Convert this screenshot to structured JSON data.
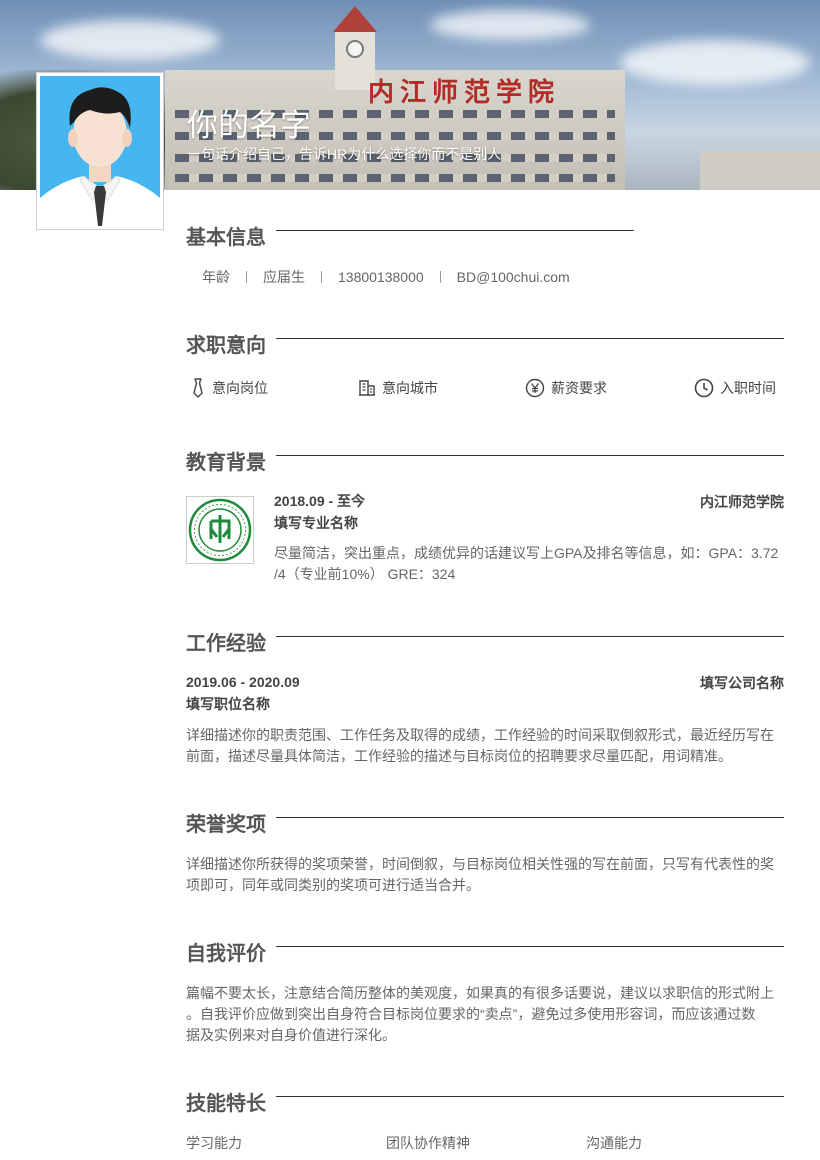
{
  "header": {
    "name": "你的名字",
    "tagline": "一句话介绍自己，告诉HR为什么选择你而不是别人",
    "campus_sign": "内江师范学院"
  },
  "sections": {
    "basic": "基本信息",
    "intent": "求职意向",
    "education": "教育背景",
    "work": "工作经验",
    "honors": "荣誉奖项",
    "self": "自我评价",
    "skills": "技能特长"
  },
  "basic_info": {
    "age": "年龄",
    "status": "应届生",
    "phone": "13800138000",
    "email": "BD@100chui.com"
  },
  "intent": {
    "position": "意向岗位",
    "city": "意向城市",
    "salary": "薪资要求",
    "start": "入职时间"
  },
  "education": {
    "period": "2018.09 - 至今",
    "school": "内江师范学院",
    "major": "填写专业名称",
    "desc_line1": "尽量简洁，突出重点，成绩优异的话建议写上GPA及排名等信息，如：GPA：3.72",
    "desc_line2": "/4（专业前10%） GRE：324"
  },
  "work": {
    "period": "2019.06 - 2020.09",
    "company": "填写公司名称",
    "title": "填写职位名称",
    "desc_line1": "详细描述你的职责范围、工作任务及取得的成绩，工作经验的时间采取倒叙形式，最近经历写在",
    "desc_line2": "前面，描述尽量具体简洁，工作经验的描述与目标岗位的招聘要求尽量匹配，用词精准。"
  },
  "honors": {
    "desc_line1": "详细描述你所获得的奖项荣誉，时间倒叙，与目标岗位相关性强的写在前面，只写有代表性的奖",
    "desc_line2": "项即可，同年或同类别的奖项可进行适当合并。"
  },
  "self_eval": {
    "desc_line1": "篇幅不要太长，注意结合简历整体的美观度，如果真的有很多话要说，建议以求职信的形式附上",
    "desc_line2": "。自我评价应做到突出自身符合目标岗位要求的“卖点”，避免过多使用形容词，而应该通过数",
    "desc_line3": "据及实例来对自身价值进行深化。"
  },
  "skills": [
    "学习能力",
    "团队协作精神",
    "沟通能力"
  ],
  "colors": {
    "avatar_bg": "#45b6f0",
    "logo_green": "#1e8a3c",
    "sign_red": "#b02c24"
  }
}
